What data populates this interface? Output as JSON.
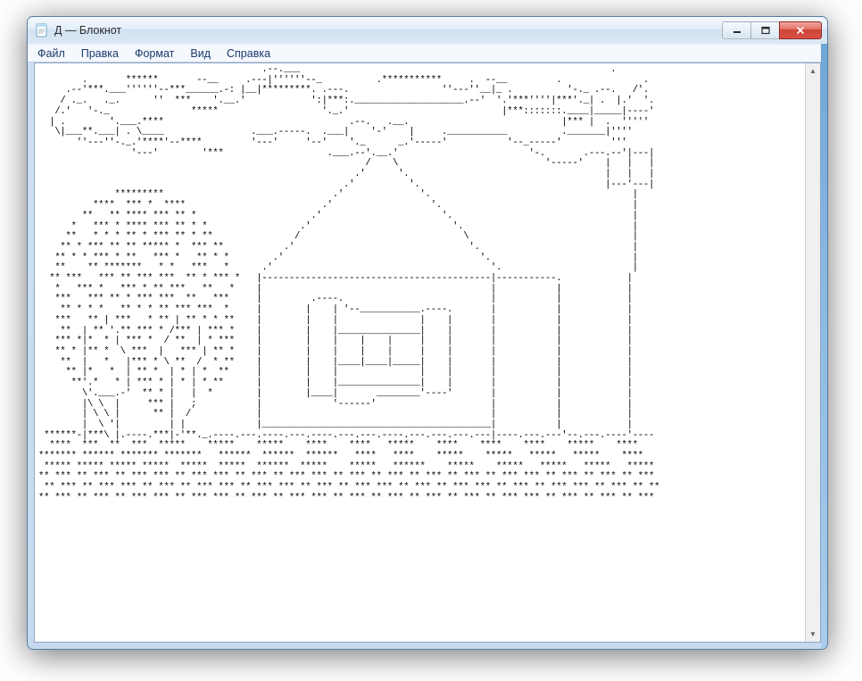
{
  "window": {
    "title": "Д — Блокнот",
    "faded_subtitle": "",
    "icon": "notepad-icon"
  },
  "controls": {
    "minimize": "minimize",
    "maximize": "maximize",
    "close": "close"
  },
  "menu": {
    "items": [
      {
        "label": "Файл"
      },
      {
        "label": "Правка"
      },
      {
        "label": "Формат"
      },
      {
        "label": "Вид"
      },
      {
        "label": "Справка"
      }
    ]
  },
  "editor": {
    "content": "                                         .--.___                                                         .\n        .       ******       --__     .---|''''''--_          .***********     .  --__         .               .\n     .--'***.___''''''--***______.-: |__|*********. .---.                 ''---''__|_ .          '-._ .--.   /'.\n    / ._.   ._.      ''  ***    '.__.'            ':|***:.____________________.--'  '.'***''''|***'._| .  |.'  '.\n   /.'   '-._               *****                   '._.'                            |***:::::::.____|_____|----'\n  | .        '.___.****                                  .--.   .__.                            |*** |  .  '''''\n   \\|___**.___| . \\____                .___.-----.  .___|    '-'    |     .___________          ._______|''''\n       ''---''-._.'****'--****         '---'     '--'    '._      _.'-----'           '--_-----'         '''\n                 '---'        '***                   .___.--'.__.'                        '-.       .---.--'|---|\n                                                            /    \\                           '-----'    |   |   |\n                                                          .'      '.                                    |   |   |\n                                                        .'          '.                                  |---'---|\n              *********                               .'              '.                                     |\n          ****  *** *  ****                         .'                  '.                                   |\n        **   ** **** *** ** *                     .'                      '.                                 |\n      *   *** * **** *** ** * *                 .'                          '.                               |\n     **   * * * ** * *** ** * **               /                              \\                              |\n    ** * *** ** ** ***** *  *** **           .'                                '.                            |\n   ** * * *** * **   *** *   ** * *        .'                                    '.                          |\n   **    ** *******   * *   ***   *      .'                                        '.                        |\n  ** ***   *** ** *** ***  ** * *** *   |------------------------------------------|-----------.            |\n   *   *** *   *** * ** ***   **   *    |                                          |           |            |\n   ***   *** ** * *** ***  **   ***     |         .----.                           |           |            |\n    ** * * *   ** * * ** *** ***  *     |        |    | '--___________.----.       |           |            |\n   ***   ** | ***   * ** | ** * * **    |        |    |               |    |       |           |            |\n    **  | ** '.** *** * /*** | *** *    |        |    |_______________|    |       |           |            |\n   *** *|*  * | *** *  / **  | * ***    |        |    |    |    |     |    |       |           |            |\n   ** * |** *  \\ ***  |   *** | ** *    |        |    |    |    |     |    |       |           |            |\n    **  |   *   |*** * \\ **  /  * **    |        |    |____|____|_____|    |       |           |            |\n     ** |*   *  | ** *  | * | *  **     |        |    |               |    |       |           |            |\n      **'.*   * | *** * | * | * **      |        |    |_______________|    |       |           |            |\n        \\'.___.-'  ** * |   |  *        |        |____|       ________'----'       |           |            |\n        |\\ \\  |     *** |   ;           |             '------'                     |           |            |\n        | \\ \\ |      ** |  /            |                                          |           |            |\n        |  \\ '|         | |             |__________________________________________|           |            |\n ******-|***\\ |.----.***|-'**._.----.---.----.---.----.---.---.----.---.---.---.---|----.---.---'--.---.----'----\n  ****  ***  **  ***  *****    *****    *****    ****    ****   *****    ****    ****    ****    *****    ****\n******* ****** ******* *******   ******  ******  ******   ****   ****    *****    *****   *****   *****    ****\n ***** ***** ***** *****  *****  *****  ******  *****    *****   ******    *****    *****   *****   *****   *****\n** *** ** *** ** *** *** ** *** *** ** *** ** *** *** ** *** ** *** ** *** ** *** ** *** *** ** *** ** *** ** ***\n ** *** ** *** *** ** *** ** *** *** ** *** *** ** *** ** *** *** ** *** ** *** *** ** *** ** *** *** ** *** ** **\n** *** ** *** ** *** *** ** *** *** ** *** ** *** *** ** *** ** *** ** *** ** *** ** *** *** ** *** ** *** ** ***"
  },
  "scrollbar": {
    "up": "▲",
    "down": "▼"
  }
}
